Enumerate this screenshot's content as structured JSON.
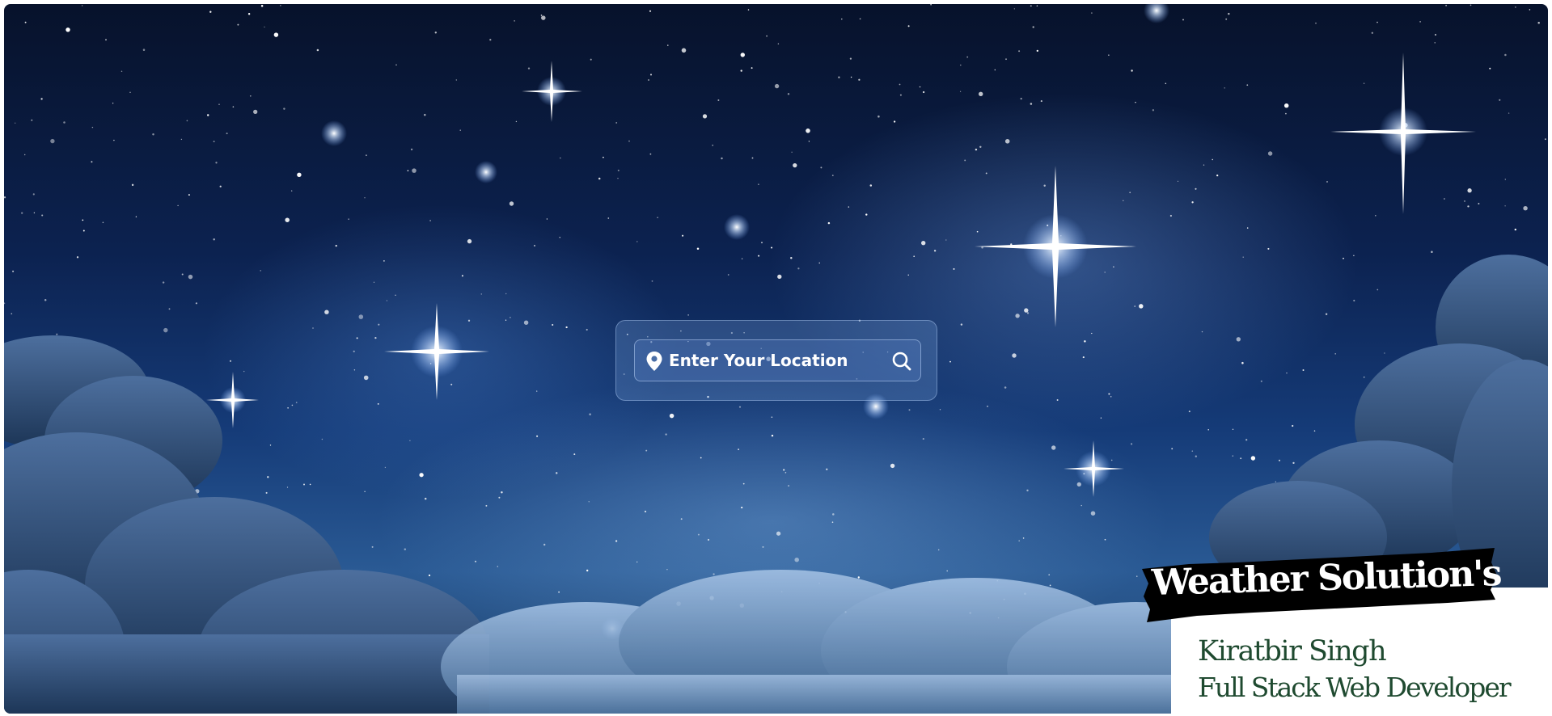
{
  "search": {
    "placeholder": "Enter Your Location"
  },
  "branding": {
    "title": "Weather Solution's",
    "author": "Kiratbir Singh",
    "role": "Full Stack Web Developer"
  },
  "icons": {
    "location": "location-pin-icon",
    "search": "search-icon"
  },
  "colors": {
    "sky_dark": "#07122b",
    "sky_mid": "#153b78",
    "accent_green": "#1f4a30",
    "banner_bg": "#000000",
    "text_light": "#ffffff"
  }
}
